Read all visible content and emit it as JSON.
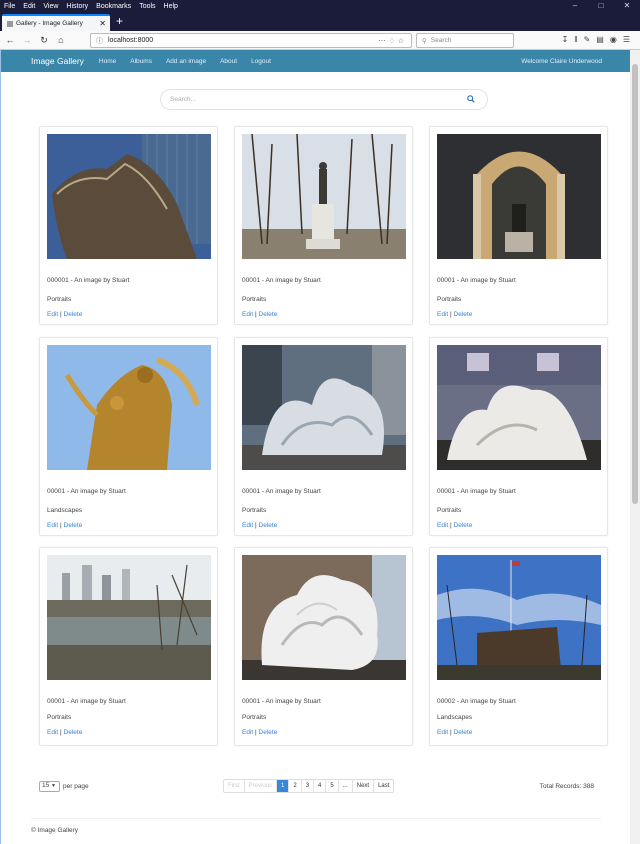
{
  "menu": [
    "File",
    "Edit",
    "View",
    "History",
    "Bookmarks",
    "Tools",
    "Help"
  ],
  "tab": {
    "title": "Gallery - Image Gallery"
  },
  "browser": {
    "url": "localhost:8000",
    "search_placeholder": "Search"
  },
  "app": {
    "brand": "Image Gallery",
    "nav": [
      "Home",
      "Albums",
      "Add an image",
      "About",
      "Logout"
    ],
    "welcome": "Welcome Claire Underwood"
  },
  "search": {
    "placeholder": "Search..."
  },
  "cards": [
    {
      "caption": "000001 - An image by Stuart",
      "category": "Portraits",
      "edit": "Edit",
      "delete": "Delete"
    },
    {
      "caption": "00001 - An image by Stuart",
      "category": "Portraits",
      "edit": "Edit",
      "delete": "Delete"
    },
    {
      "caption": "00001 - An image by Stuart",
      "category": "Portraits",
      "edit": "Edit",
      "delete": "Delete"
    },
    {
      "caption": "00001 - An image by Stuart",
      "category": "Landscapes",
      "edit": "Edit",
      "delete": "Delete"
    },
    {
      "caption": "00001 - An image by Stuart",
      "category": "Portraits",
      "edit": "Edit",
      "delete": "Delete"
    },
    {
      "caption": "00001 - An image by Stuart",
      "category": "Portraits",
      "edit": "Edit",
      "delete": "Delete"
    },
    {
      "caption": "00001 - An image by Stuart",
      "category": "Portraits",
      "edit": "Edit",
      "delete": "Delete"
    },
    {
      "caption": "00001 - An image by Stuart",
      "category": "Portraits",
      "edit": "Edit",
      "delete": "Delete"
    },
    {
      "caption": "00002 - An image by Stuart",
      "category": "Landscapes",
      "edit": "Edit",
      "delete": "Delete"
    }
  ],
  "pagination": {
    "per_page_value": "15",
    "per_page_label": "per page",
    "pages": [
      "First",
      "Previous",
      "1",
      "2",
      "3",
      "4",
      "5",
      "...",
      "Next",
      "Last"
    ],
    "active": "1",
    "total": "Total Records: 388"
  },
  "footer": {
    "copyright": "© Image Gallery"
  },
  "colors": {
    "navbar": "#3a86a8",
    "link": "#3a82d4",
    "active_page": "#3a86d8"
  }
}
